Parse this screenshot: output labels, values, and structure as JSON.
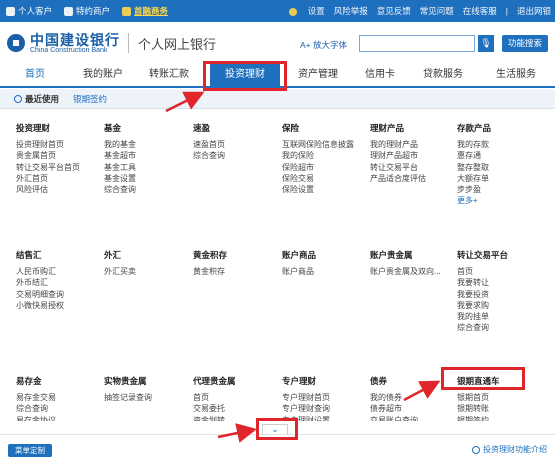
{
  "topbar": {
    "personal": "个人客户",
    "private": "特约商户",
    "current": "首融商务",
    "settings": "设置",
    "report": "风险举报",
    "feedback": "意见反馈",
    "faq": "常见问题",
    "service": "在线客服",
    "logout": "退出网银"
  },
  "header": {
    "bank_cn": "中国建设银行",
    "bank_en": "China Construction Bank",
    "site_title": "个人网上银行",
    "font_btn": "A+ 放大字体",
    "search_btn": "功能搜索"
  },
  "nav": {
    "items": [
      "首页",
      "我的账户",
      "转账汇款",
      "投资理财",
      "资产管理",
      "信用卡",
      "贷款服务",
      "生活服务"
    ]
  },
  "subnav": {
    "recent": "最近使用",
    "contract": "银期签约"
  },
  "menu": {
    "row1": [
      {
        "title": "投资理财",
        "items": [
          "投资理财首页",
          "贵金属首页",
          "转让交易平台首页",
          "外汇首页",
          "风险评估"
        ]
      },
      {
        "title": "基金",
        "items": [
          "我的基金",
          "基金超市",
          "基金工具",
          "基金设置",
          "综合查询"
        ]
      },
      {
        "title": "速盈",
        "items": [
          "速盈首页",
          "综合查询"
        ]
      },
      {
        "title": "保险",
        "items": [
          "互联网保险信息披露",
          "我的保险",
          "保险超市",
          "保险交易",
          "保险设置"
        ]
      },
      {
        "title": "理财产品",
        "items": [
          "我的理财产品",
          "理财产品超市",
          "转让交易平台",
          "产品适合度评估"
        ]
      },
      {
        "title": "存款产品",
        "items": [
          "我的存款",
          "惠存通",
          "整存整取",
          "大额存单",
          "步步盈",
          "更多+"
        ]
      }
    ],
    "row2": [
      {
        "title": "结售汇",
        "items": [
          "人民币购汇",
          "外币结汇",
          "交易明细查询",
          "小微快易授权"
        ]
      },
      {
        "title": "外汇",
        "items": [
          "外汇买卖"
        ]
      },
      {
        "title": "黄金积存",
        "items": [
          "黄金积存"
        ]
      },
      {
        "title": "账户商品",
        "items": [
          "账户商品"
        ]
      },
      {
        "title": "账户贵金属",
        "items": [
          "账户贵金属及双向..."
        ]
      },
      {
        "title": "转让交易平台",
        "items": [
          "首页",
          "我要转让",
          "我要投资",
          "我要求购",
          "我的挂单",
          "综合查询"
        ]
      }
    ],
    "row3": [
      {
        "title": "易存金",
        "items": [
          "易存金交易",
          "综合查询",
          "易存金协议"
        ]
      },
      {
        "title": "实物贵金属",
        "items": [
          "抽签记录查询"
        ]
      },
      {
        "title": "代理贵金属",
        "items": [
          "首页",
          "交易委托",
          "资金划转"
        ]
      },
      {
        "title": "专户理财",
        "items": [
          "专户理财首页",
          "专户理财查询",
          "专户理财设置"
        ]
      },
      {
        "title": "债券",
        "items": [
          "我的债券",
          "债券超市",
          "交易账户查询"
        ]
      },
      {
        "title": "银期直通车",
        "items": [
          "银期首页",
          "银期转账",
          "银期签约"
        ]
      }
    ]
  },
  "footer": {
    "custom": "菜单定制",
    "intro": "投资理财功能介绍",
    "collapse": "⌄"
  }
}
